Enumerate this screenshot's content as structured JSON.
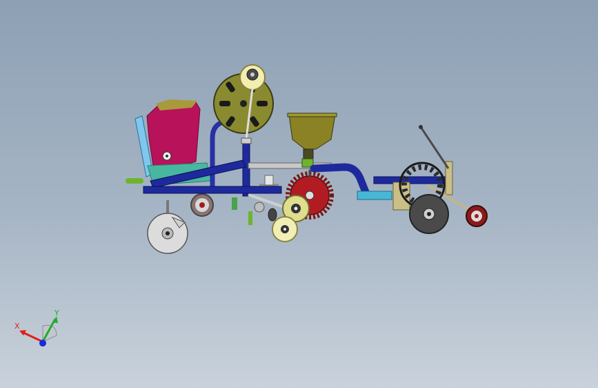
{
  "viewport": {
    "background_top": "#8da0b4",
    "background_bottom": "#c9d2db"
  },
  "triad": {
    "x_label": "X",
    "y_label": "Y",
    "x_color": "#e0201a",
    "y_color": "#1fae2c",
    "z_color": "#1a2ad8"
  },
  "model": {
    "parts": [
      "hopper",
      "fertilizer-box",
      "film-roll",
      "seed-hopper",
      "frame",
      "seed-wheel",
      "press-wheel",
      "front-disc",
      "rear-disc",
      "tail-wheel",
      "spike-wheel"
    ],
    "colors": {
      "frame": "#1e2a9c",
      "fertilizer_box": "#b8125a",
      "hopper": "#8a8224",
      "film_roll": "#8a8a30",
      "seed_wheel": "#b31b23",
      "light_blue": "#7fc7ee",
      "teal": "#48b7a0",
      "disc": "#d8d8d8",
      "dark_disc": "#4a4a4a"
    }
  }
}
